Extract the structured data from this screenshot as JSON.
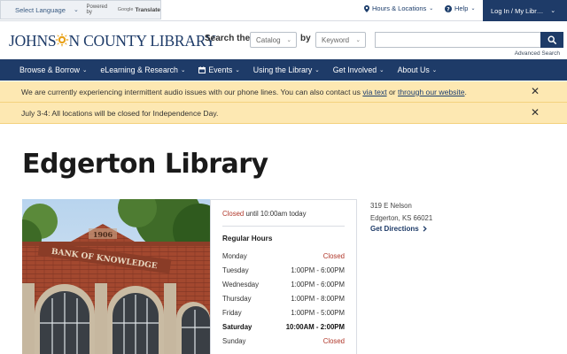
{
  "utility": {
    "language_label": "Select Language",
    "powered_by": "Powered by",
    "google_word": "Google",
    "translate_word": "Translate",
    "hours_locations": "Hours & Locations",
    "help": "Help",
    "login": "Log In / My Libr…"
  },
  "header": {
    "logo_prefix": "JOHNS",
    "logo_suffix": "N COUNTY LIBRARY",
    "search_label": "Search the",
    "search_scope": "Catalog",
    "by_label": "by",
    "search_field": "Keyword",
    "search_value": "",
    "advanced_search": "Advanced Search"
  },
  "nav": {
    "items": [
      {
        "label": "Browse & Borrow"
      },
      {
        "label": "eLearning & Research"
      },
      {
        "label": "Events"
      },
      {
        "label": "Using the Library"
      },
      {
        "label": "Get Involved"
      },
      {
        "label": "About Us"
      }
    ]
  },
  "alerts": [
    {
      "text_before": "We are currently experiencing intermittent audio issues with our phone lines. You can also contact us ",
      "link1": "via text",
      "text_middle": " or ",
      "link2": "through our website",
      "text_after": "."
    },
    {
      "text": "July 3-4: All locations will be closed for Independence Day."
    }
  ],
  "page_title": "Edgerton Library",
  "photo": {
    "year": "1906",
    "sign": "BANK OF KNOWLEDGE"
  },
  "hours": {
    "status_word": "Closed",
    "status_rest": " until 10:00am today",
    "regular_title": "Regular Hours",
    "rows": [
      {
        "day": "Monday",
        "time": "Closed"
      },
      {
        "day": "Tuesday",
        "time": "1:00PM - 6:00PM"
      },
      {
        "day": "Wednesday",
        "time": "1:00PM - 6:00PM"
      },
      {
        "day": "Thursday",
        "time": "1:00PM - 8:00PM"
      },
      {
        "day": "Friday",
        "time": "1:00PM - 5:00PM"
      },
      {
        "day": "Saturday",
        "time": "10:00AM - 2:00PM"
      },
      {
        "day": "Sunday",
        "time": "Closed"
      }
    ]
  },
  "address": {
    "line1": "319 E Nelson",
    "line2": "Edgerton, KS 66021",
    "directions": "Get Directions"
  },
  "colors": {
    "brand_navy": "#1e3b68",
    "alert_bg": "#fde8b2",
    "closed_red": "#b0372a",
    "logo_sun": "#e9a21a"
  }
}
